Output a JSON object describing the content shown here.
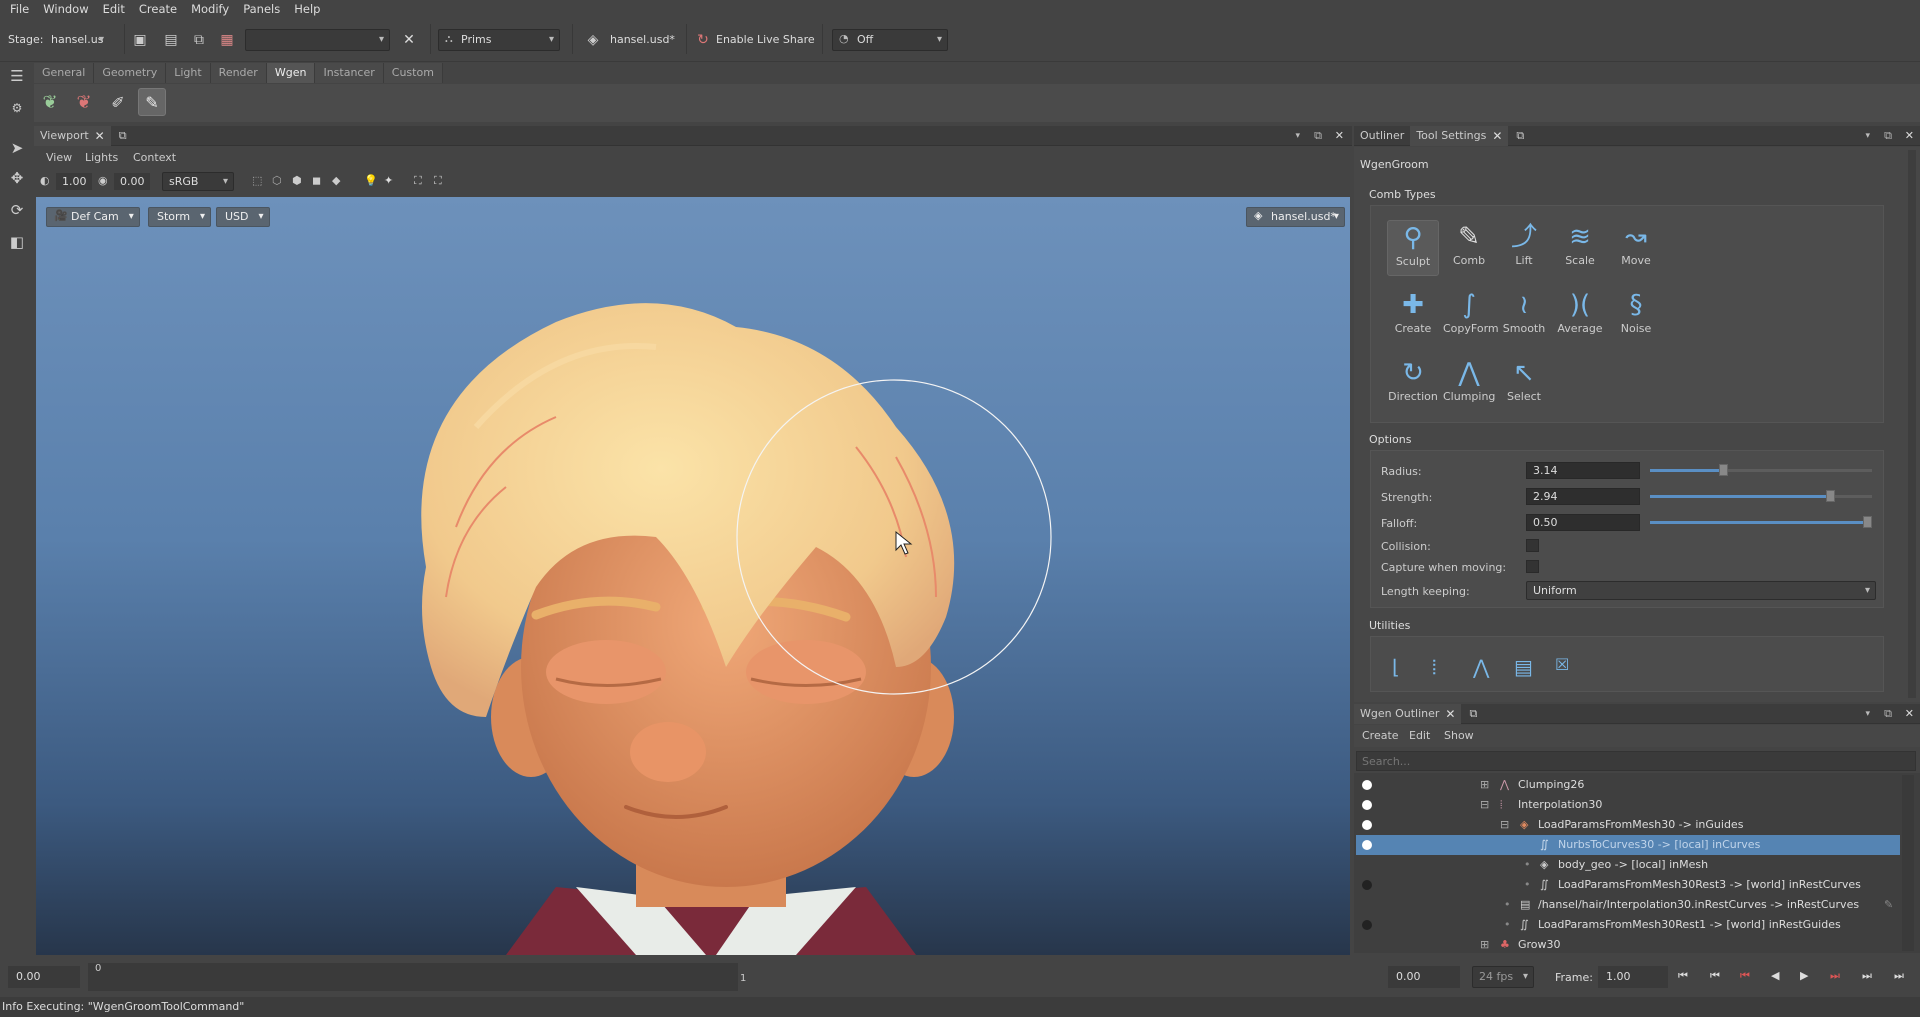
{
  "menu": [
    "File",
    "Window",
    "Edit",
    "Create",
    "Modify",
    "Panels",
    "Help"
  ],
  "toolbar": {
    "stage_label": "Stage:",
    "stage_value": "hansel.us",
    "prims_label": "Prims",
    "layer_label": "hansel.usd*",
    "live_share_label": "Enable Live Share",
    "off_label": "Off"
  },
  "shelf_tabs": [
    "General",
    "Geometry",
    "Light",
    "Render",
    "Wgen",
    "Instancer",
    "Custom"
  ],
  "viewport": {
    "tab_label": "Viewport",
    "menu": [
      "View",
      "Lights",
      "Context"
    ],
    "exposure": "1.00",
    "gamma": "0.00",
    "colorspace": "sRGB",
    "camera": "Def Cam",
    "renderer": "Storm",
    "usd": "USD",
    "layer_chip": "hansel.usd*"
  },
  "tool_panel": {
    "tabs": [
      "Outliner",
      "Tool Settings"
    ],
    "title": "WgenGroom",
    "comb_types_label": "Comb Types",
    "comb_types": [
      "Sculpt",
      "Comb",
      "Lift",
      "Scale",
      "Move",
      "Create",
      "CopyForm",
      "Smooth",
      "Average",
      "Noise",
      "Direction",
      "Clumping",
      "Select"
    ],
    "options_label": "Options",
    "radius_label": "Radius:",
    "radius_value": "3.14",
    "radius_level": 0.33,
    "strength_label": "Strength:",
    "strength_value": "2.94",
    "strength_level": 0.81,
    "falloff_label": "Falloff:",
    "falloff_value": "0.50",
    "falloff_level": 1.0,
    "collision_label": "Collision:",
    "capture_label": "Capture when moving:",
    "length_label": "Length keeping:",
    "length_value": "Uniform",
    "utilities_label": "Utilities"
  },
  "wgen_outliner": {
    "tab_label": "Wgen Outliner",
    "menu": [
      "Create",
      "Edit",
      "Show"
    ],
    "search_placeholder": "Search...",
    "rows": [
      "Clumping26",
      "Interpolation30",
      "LoadParamsFromMesh30 -> inGuides",
      "NurbsToCurves30 -> [local] inCurves",
      "body_geo -> [local] inMesh",
      "LoadParamsFromMesh30Rest3 -> [world] inRestCurves",
      "/hansel/hair/Interpolation30.inRestCurves -> inRestCurves",
      "LoadParamsFromMesh30Rest1 -> [world] inRestGuides",
      "Grow30"
    ]
  },
  "timeline": {
    "start": "0.00",
    "tick0": "0",
    "tick1": "1",
    "current": "0.00",
    "fps": "24 fps",
    "frame_label": "Frame:",
    "frame_value": "1.00"
  },
  "status": "Info Executing: \"WgenGroomToolCommand\""
}
